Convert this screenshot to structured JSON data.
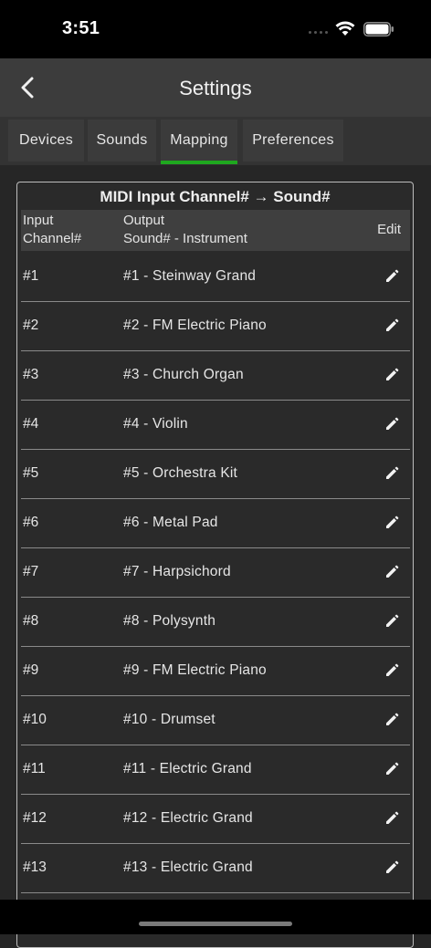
{
  "status_bar": {
    "time": "3:51"
  },
  "nav": {
    "title": "Settings",
    "back_icon": "chevron-left-icon"
  },
  "tabs": [
    {
      "label": "Devices",
      "active": false
    },
    {
      "label": "Sounds",
      "active": false
    },
    {
      "label": "Mapping",
      "active": true
    },
    {
      "label": "Preferences",
      "active": false
    }
  ],
  "colors": {
    "accent": "#1fa81f",
    "background": "#262626",
    "nav": "#3c3c3c"
  },
  "mapping": {
    "title": "MIDI Input Channel# → Sound#",
    "headers": {
      "input_line1": "Input",
      "input_line2": "Channel#",
      "output_line1": "Output",
      "output_line2": "Sound# - Instrument",
      "edit": "Edit"
    },
    "rows": [
      {
        "channel": "#1",
        "output": "#1 - Steinway Grand"
      },
      {
        "channel": "#2",
        "output": "#2 - FM Electric Piano"
      },
      {
        "channel": "#3",
        "output": "#3 - Church Organ"
      },
      {
        "channel": "#4",
        "output": "#4 - Violin"
      },
      {
        "channel": "#5",
        "output": "#5 - Orchestra Kit"
      },
      {
        "channel": "#6",
        "output": "#6 - Metal Pad"
      },
      {
        "channel": "#7",
        "output": "#7 - Harpsichord"
      },
      {
        "channel": "#8",
        "output": "#8 - Polysynth"
      },
      {
        "channel": "#9",
        "output": "#9 - FM Electric Piano"
      },
      {
        "channel": "#10",
        "output": "#10 - Drumset"
      },
      {
        "channel": "#11",
        "output": "#11 - Electric Grand"
      },
      {
        "channel": "#12",
        "output": "#12 - Electric Grand"
      },
      {
        "channel": "#13",
        "output": "#13 - Electric Grand"
      }
    ]
  }
}
